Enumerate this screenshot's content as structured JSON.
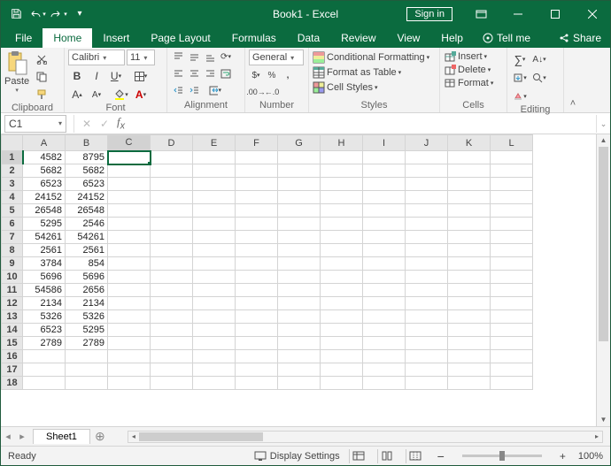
{
  "title": "Book1 - Excel",
  "signin": "Sign in",
  "tabs": {
    "file": "File",
    "home": "Home",
    "insert": "Insert",
    "pagelayout": "Page Layout",
    "formulas": "Formulas",
    "data": "Data",
    "review": "Review",
    "view": "View",
    "help": "Help",
    "tellme": "Tell me",
    "share": "Share"
  },
  "ribbon": {
    "paste": "Paste",
    "clipboard": "Clipboard",
    "fontname": "Calibri",
    "fontsize": "11",
    "font": "Font",
    "alignment": "Alignment",
    "numberfmt": "General",
    "number": "Number",
    "condfmt": "Conditional Formatting",
    "fmttable": "Format as Table",
    "cellstyles": "Cell Styles",
    "styles": "Styles",
    "insert": "Insert",
    "delete": "Delete",
    "format": "Format",
    "cells": "Cells",
    "editing": "Editing"
  },
  "namebox": "C1",
  "formula": "",
  "columns": [
    "A",
    "B",
    "C",
    "D",
    "E",
    "F",
    "G",
    "H",
    "I",
    "J",
    "K",
    "L"
  ],
  "sel": {
    "col": "C",
    "row": 1
  },
  "rows": 18,
  "data": {
    "A": [
      4582,
      5682,
      6523,
      24152,
      26548,
      5295,
      54261,
      2561,
      3784,
      5696,
      54586,
      2134,
      5326,
      6523,
      2789
    ],
    "B": [
      8795,
      5682,
      6523,
      24152,
      26548,
      2546,
      54261,
      2561,
      854,
      5696,
      2656,
      2134,
      5326,
      5295,
      2789
    ]
  },
  "sheettab": "Sheet1",
  "status": {
    "ready": "Ready",
    "display": "Display Settings",
    "zoom": "100%"
  }
}
